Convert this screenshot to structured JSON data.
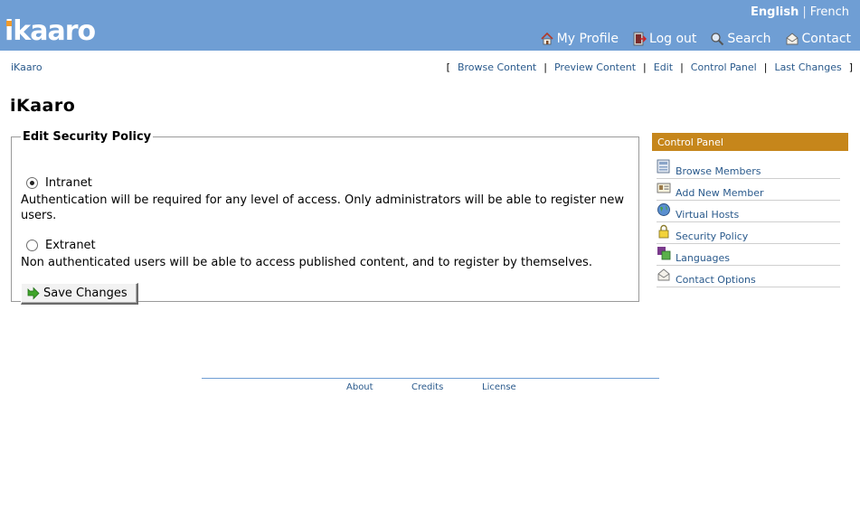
{
  "header": {
    "logo": "ikaaro",
    "languages": {
      "active": "English",
      "separator": "|",
      "other": "French"
    },
    "nav": [
      {
        "label": "My Profile",
        "icon": "home-icon"
      },
      {
        "label": "Log out",
        "icon": "logout-icon"
      },
      {
        "label": "Search",
        "icon": "search-icon"
      },
      {
        "label": "Contact",
        "icon": "contact-icon"
      }
    ]
  },
  "breadcrumb": "iKaaro",
  "actions": {
    "open": "[",
    "close": "]",
    "separator": "|",
    "items": [
      "Browse Content",
      "Preview Content",
      "Edit",
      "Control Panel",
      "Last Changes"
    ]
  },
  "page_title": "iKaaro",
  "policy": {
    "legend": "Edit Security Policy",
    "options": [
      {
        "label": "Intranet",
        "selected": true,
        "description": "Authentication will be required for any level of access. Only administrators will be able to register new users."
      },
      {
        "label": "Extranet",
        "selected": false,
        "description": "Non authenticated users will be able to access published content, and to register by themselves."
      }
    ],
    "save_label": "Save Changes"
  },
  "control_panel": {
    "title": "Control Panel",
    "items": [
      {
        "label": "Browse Members",
        "icon": "members-icon"
      },
      {
        "label": "Add New Member",
        "icon": "add-member-icon"
      },
      {
        "label": "Virtual Hosts",
        "icon": "globe-icon"
      },
      {
        "label": "Security Policy",
        "icon": "lock-icon"
      },
      {
        "label": "Languages",
        "icon": "languages-icon"
      },
      {
        "label": "Contact Options",
        "icon": "envelope-icon"
      }
    ]
  },
  "footer": {
    "about": "About",
    "credits": "Credits",
    "license": "License"
  },
  "colors": {
    "header": "#6f9ed4",
    "panel_head": "#c6861b",
    "link": "#2a5a8c"
  }
}
